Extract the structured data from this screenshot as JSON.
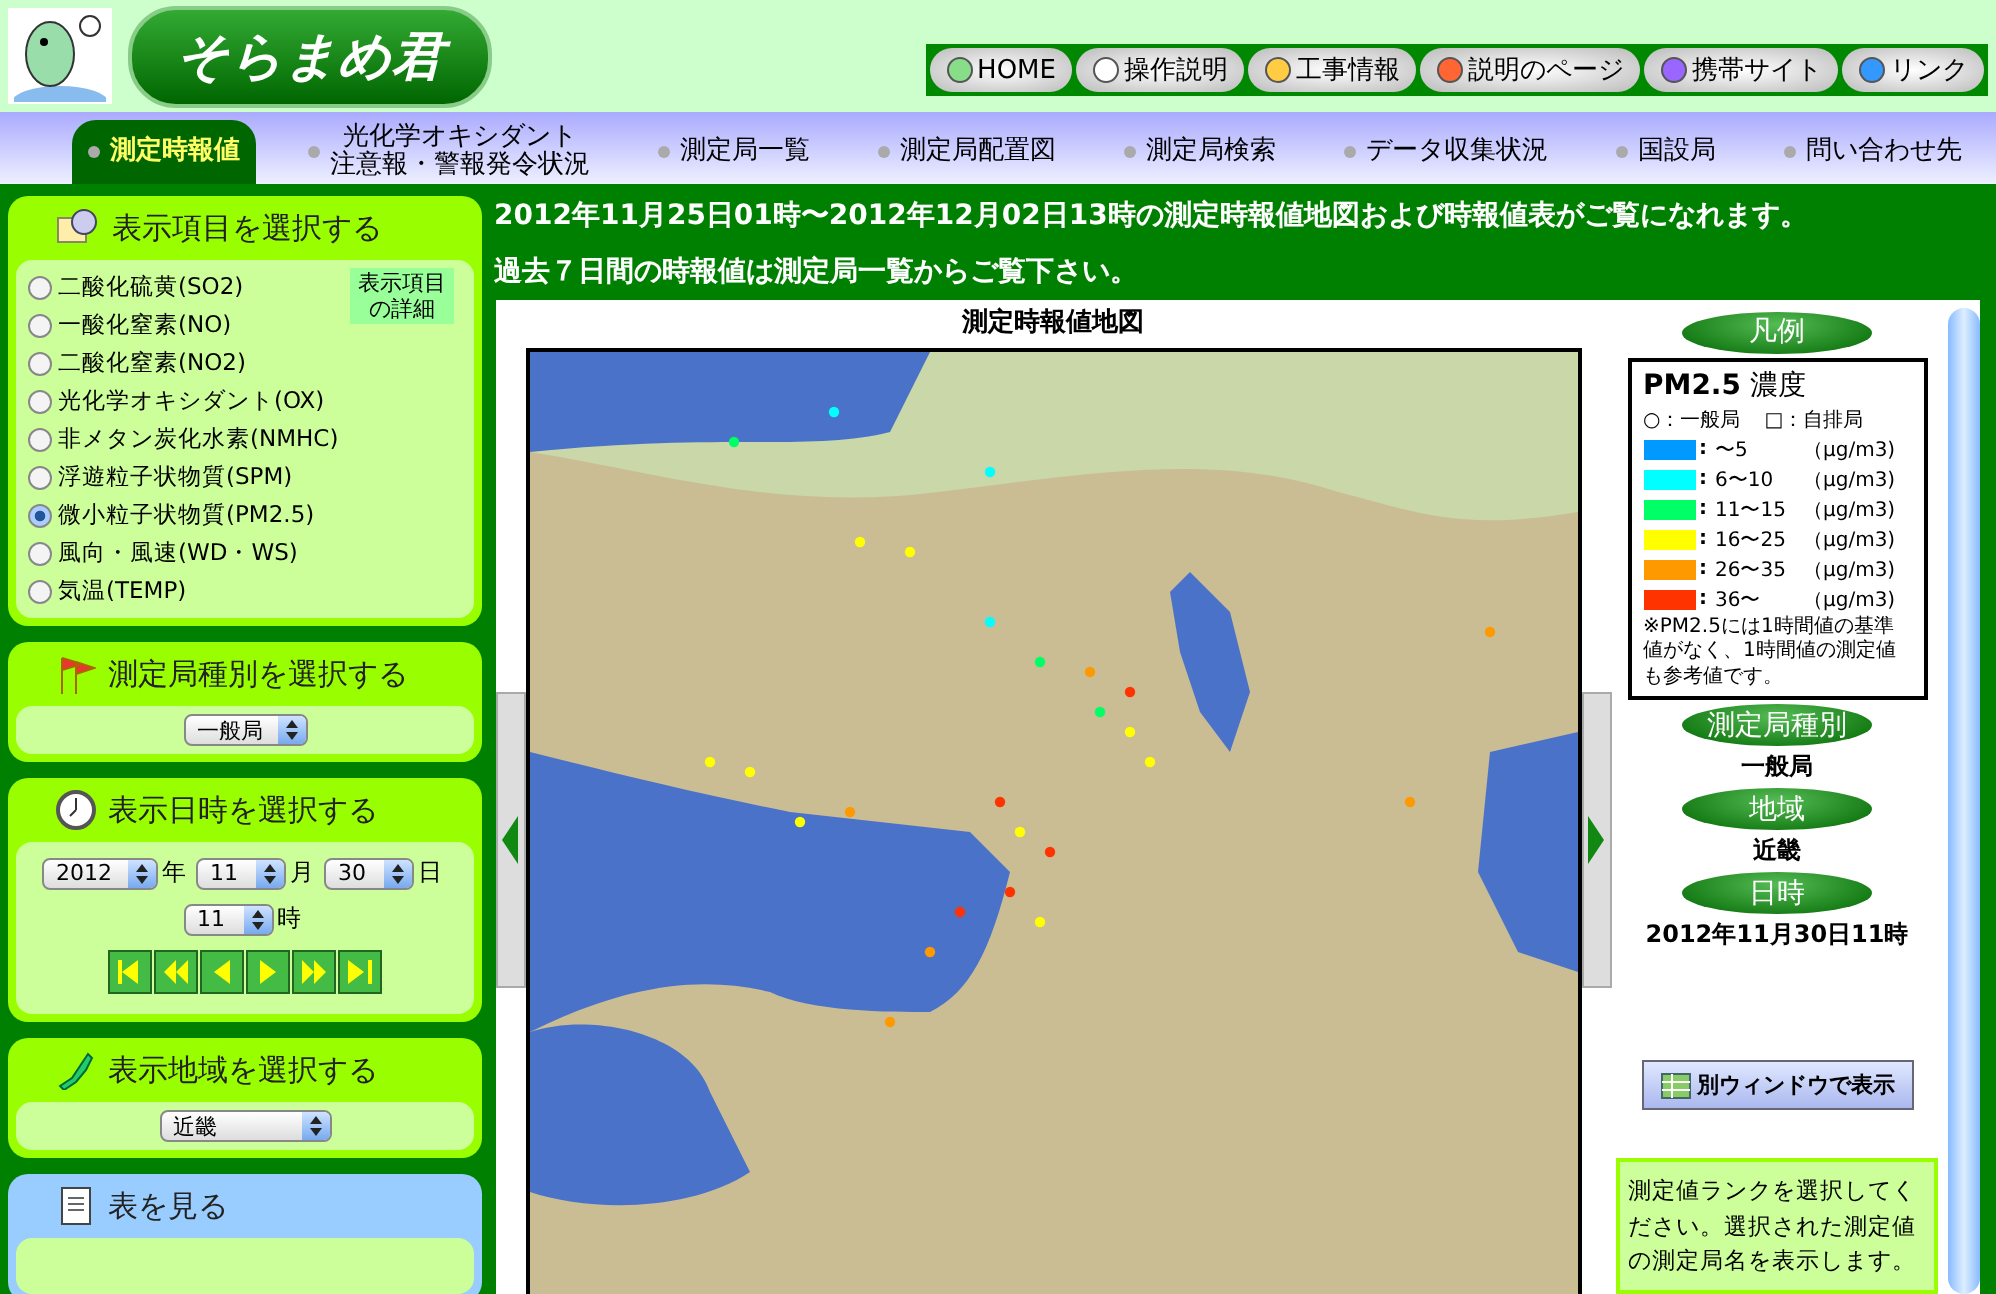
{
  "header": {
    "logo_title": "そらまめ君",
    "buttons": [
      {
        "label": "HOME"
      },
      {
        "label": "操作説明"
      },
      {
        "label": "工事情報"
      },
      {
        "label": "説明のページ"
      },
      {
        "label": "携帯サイト"
      },
      {
        "label": "リンク"
      }
    ]
  },
  "nav": [
    {
      "label": "測定時報値",
      "selected": true
    },
    {
      "lines": [
        "光化学オキシダント",
        "注意報・警報発令状況"
      ],
      "selected": false
    },
    {
      "label": "測定局一覧",
      "selected": false
    },
    {
      "label": "測定局配置図",
      "selected": false
    },
    {
      "label": "測定局検索",
      "selected": false
    },
    {
      "label": "データ収集状況",
      "selected": false
    },
    {
      "label": "国設局",
      "selected": false
    },
    {
      "label": "問い合わせ先",
      "selected": false
    }
  ],
  "notice": [
    "2012年11月25日01時〜2012年12月02日13時の測定時報値地図および時報値表がご覧になれます。",
    "過去７日間の時報値は測定局一覧からご覧下さい。"
  ],
  "sidebar": {
    "items": {
      "title": "表示項目を選択する",
      "detail_tag": [
        "表示項目",
        "の詳細"
      ],
      "options": [
        {
          "label": "二酸化硫黄(SO2)",
          "selected": false
        },
        {
          "label": "一酸化窒素(NO)",
          "selected": false
        },
        {
          "label": "二酸化窒素(NO2)",
          "selected": false
        },
        {
          "label": "光化学オキシダント(OX)",
          "selected": false
        },
        {
          "label": "非メタン炭化水素(NMHC)",
          "selected": false
        },
        {
          "label": "浮遊粒子状物質(SPM)",
          "selected": false
        },
        {
          "label": "微小粒子状物質(PM2.5)",
          "selected": true
        },
        {
          "label": "風向・風速(WD・WS)",
          "selected": false
        },
        {
          "label": "気温(TEMP)",
          "selected": false
        }
      ]
    },
    "station_type": {
      "title": "測定局種別を選択する",
      "value": "一般局"
    },
    "datetime": {
      "title": "表示日時を選択する",
      "year": "2012",
      "year_unit": "年",
      "month": "11",
      "month_unit": "月",
      "day": "30",
      "day_unit": "日",
      "hour": "11",
      "hour_unit": "時"
    },
    "region": {
      "title": "表示地域を選択する",
      "value": "近畿"
    },
    "table": {
      "title": "表を見る"
    }
  },
  "map": {
    "title": "測定時報値地図"
  },
  "legend": {
    "button": "凡例",
    "title": "**PM2.5** 濃度",
    "symbols": [
      "○：一般局",
      "□：自排局"
    ],
    "rows": [
      {
        "color": "#0099ff",
        "sep": ":",
        "range": "〜5",
        "unit": "（μg/m3)"
      },
      {
        "color": "#00ffff",
        "sep": ":",
        "range": "6〜10",
        "unit": "（μg/m3)"
      },
      {
        "color": "#00ff66",
        "sep": ":",
        "range": "11〜15",
        "unit": "（μg/m3)"
      },
      {
        "color": "#ffff00",
        "sep": ":",
        "range": "16〜25",
        "unit": "（μg/m3)"
      },
      {
        "color": "#ff9900",
        "sep": ":",
        "range": "26〜35",
        "unit": "（μg/m3)"
      },
      {
        "color": "#ff3300",
        "sep": ":",
        "range": "36〜",
        "unit": "（μg/m3)"
      }
    ],
    "note": "※PM2.5には1時間値の基準値がなく、1時間値の測定値も参考値です。"
  },
  "info": [
    {
      "label": "測定局種別",
      "value": "一般局"
    },
    {
      "label": "地域",
      "value": "近畿"
    },
    {
      "label": "日時",
      "value": "2012年11月30日11時"
    }
  ],
  "window_button": "別ウィンドウで表示",
  "hint": "測定値ランクを選択してください。選択された測定値の測定局名を表示します。"
}
